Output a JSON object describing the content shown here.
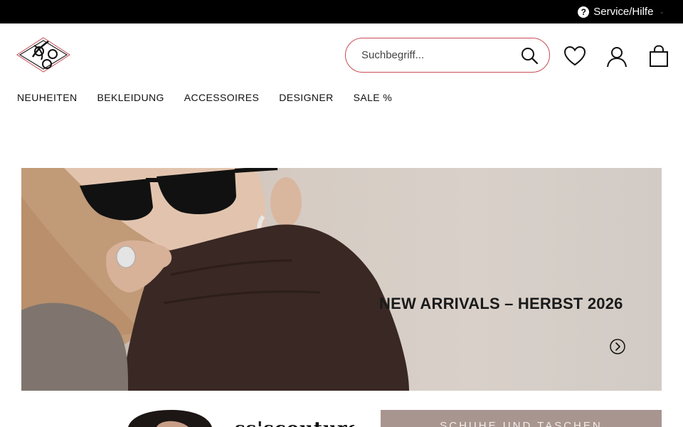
{
  "topbar": {
    "service_label": "Service/Hilfe",
    "help_icon": "question-circle-icon",
    "help_glyph": "?"
  },
  "header": {
    "logo_icon": "monogram-logo",
    "search": {
      "placeholder": "Suchbegriff..."
    },
    "icons": [
      "search-icon",
      "heart-icon",
      "user-icon",
      "bag-icon"
    ]
  },
  "nav": {
    "items": [
      {
        "label": "NEUHEITEN"
      },
      {
        "label": "BEKLEIDUNG"
      },
      {
        "label": "ACCESSOIRES"
      },
      {
        "label": "DESIGNER"
      },
      {
        "label": "SALE %"
      }
    ]
  },
  "hero": {
    "headline": "NEW ARRIVALS – HERBST 2026",
    "arrow_icon": "chevron-right-circle-icon"
  },
  "teasers": {
    "left_script": "ss'scouture",
    "right_label": "SCHUHE UND TASCHEN"
  },
  "colors": {
    "topbar_bg": "#000000",
    "search_border": "#c94b55",
    "teaser_right_bg": "#a89590"
  }
}
